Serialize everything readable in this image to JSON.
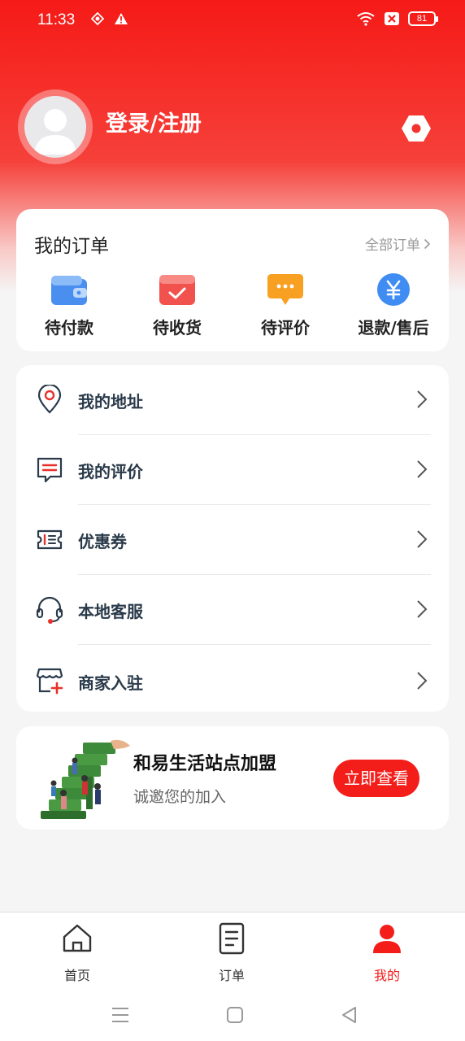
{
  "status_bar": {
    "time": "11:33",
    "battery": "81"
  },
  "profile": {
    "login_label": "登录/注册"
  },
  "orders": {
    "title": "我的订单",
    "all_label": "全部订单",
    "items": [
      {
        "label": "待付款",
        "icon": "wallet-icon"
      },
      {
        "label": "待收货",
        "icon": "package-icon"
      },
      {
        "label": "待评价",
        "icon": "comment-icon"
      },
      {
        "label": "退款/售后",
        "icon": "refund-yen-icon"
      }
    ]
  },
  "menu": [
    {
      "label": "我的地址",
      "icon": "location-pin-icon"
    },
    {
      "label": "我的评价",
      "icon": "review-message-icon"
    },
    {
      "label": "优惠券",
      "icon": "coupon-icon"
    },
    {
      "label": "本地客服",
      "icon": "headset-icon"
    },
    {
      "label": "商家入驻",
      "icon": "store-add-icon"
    }
  ],
  "promo": {
    "title": "和易生活站点加盟",
    "subtitle": "诚邀您的加入",
    "button": "立即查看"
  },
  "tabs": [
    {
      "label": "首页",
      "icon": "home-icon"
    },
    {
      "label": "订单",
      "icon": "order-document-icon"
    },
    {
      "label": "我的",
      "icon": "user-profile-icon"
    }
  ],
  "colors": {
    "accent": "#f31d1a",
    "text_dark": "#2a3a4a",
    "muted": "#999999"
  }
}
